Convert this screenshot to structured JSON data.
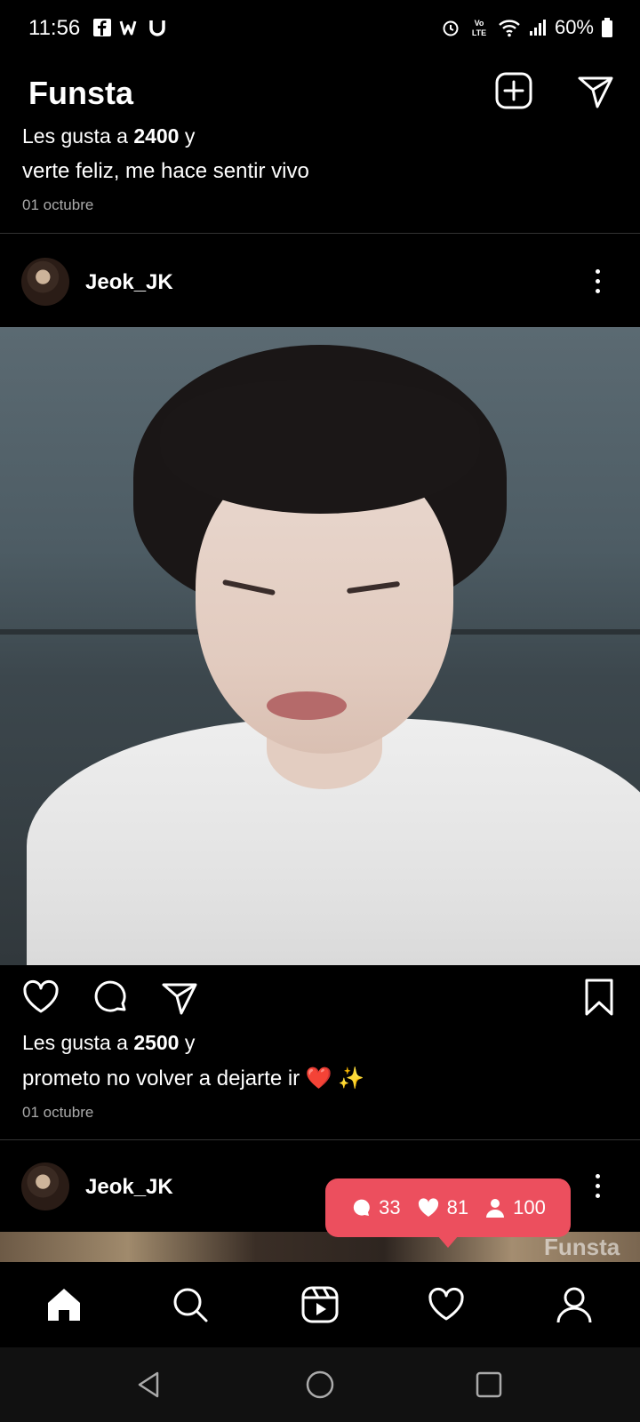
{
  "status_bar": {
    "time": "11:56",
    "battery": "60%",
    "app_icons": [
      "facebook-icon",
      "webtoon-icon",
      "u-app-icon"
    ],
    "system_icons": [
      "alarm-icon",
      "volte-icon",
      "wifi-icon",
      "signal-icon",
      "battery-icon"
    ],
    "volte": "Vo LTE"
  },
  "header": {
    "title": "Funsta",
    "new_post_icon": "plus-square-icon",
    "direct_icon": "paper-plane-icon"
  },
  "previous_post": {
    "likes_prefix": "Les gusta a ",
    "likes_count": "2400",
    "likes_suffix": " y",
    "caption": "verte feliz, me hace sentir vivo",
    "date": "01 octubre"
  },
  "post": {
    "username": "Jeok_JK",
    "likes_prefix": "Les gusta a ",
    "likes_count": "2500",
    "likes_suffix": " y",
    "caption": "prometo no volver a dejarte ir ❤️ ✨",
    "date": "01 octubre"
  },
  "next_post": {
    "username": "Jeok_JK",
    "watermark": "Funsta"
  },
  "notification": {
    "comments": "33",
    "likes": "81",
    "followers": "100",
    "color": "#ec4f5e"
  },
  "tab_bar": {
    "items": [
      "home-icon",
      "search-icon",
      "reels-icon",
      "heart-icon",
      "profile-icon"
    ]
  },
  "nav_bar": {
    "items": [
      "back-icon",
      "home-circle-icon",
      "recents-icon"
    ]
  }
}
